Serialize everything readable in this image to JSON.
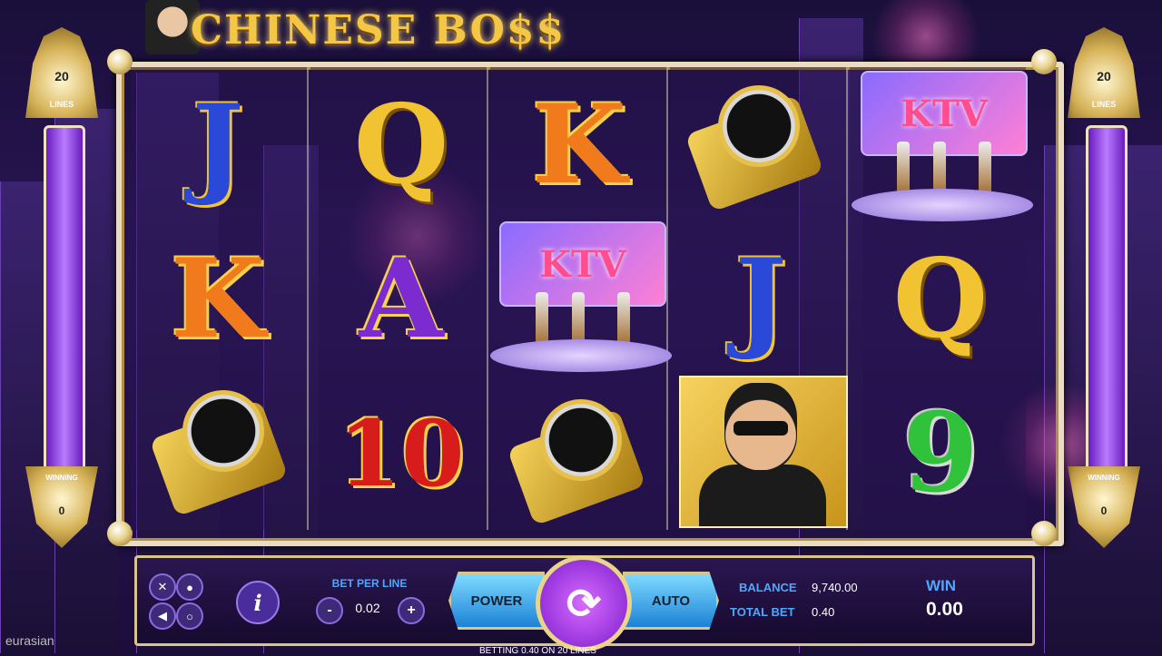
{
  "game": {
    "title": "CHINESE BO$$",
    "brand": "eurasian"
  },
  "left_meter": {
    "lines": "20",
    "lines_label": "LINES",
    "winning_label": "WINNING",
    "winning_value": "0"
  },
  "right_meter": {
    "lines": "20",
    "lines_label": "LINES",
    "winning_label": "WINNING",
    "winning_value": "0"
  },
  "reels": [
    [
      "J",
      "K",
      "watch"
    ],
    [
      "Q",
      "A",
      "10"
    ],
    [
      "K",
      "KTV",
      "watch"
    ],
    [
      "watch",
      "J",
      "boss"
    ],
    [
      "KTV",
      "Q",
      "9"
    ]
  ],
  "ktv_sign_text": "KTV",
  "controls": {
    "bet_per_line_label": "BET PER LINE",
    "bet_per_line_value": "0.02",
    "minus_label": "-",
    "plus_label": "+",
    "info_label": "i",
    "power_label": "POWER",
    "auto_label": "AUTO",
    "spin_label": "⟳",
    "balance_label": "BALANCE",
    "balance_value": "9,740.00",
    "total_bet_label": "TOTAL BET",
    "total_bet_value": "0.40",
    "win_label": "WIN",
    "win_value": "0.00"
  },
  "footer_text": "BETTING 0.40 ON 20 LINES",
  "colors": {
    "accent_blue": "#4ea7ff",
    "gold": "#f3c646",
    "purple": "#7a1ccc"
  }
}
